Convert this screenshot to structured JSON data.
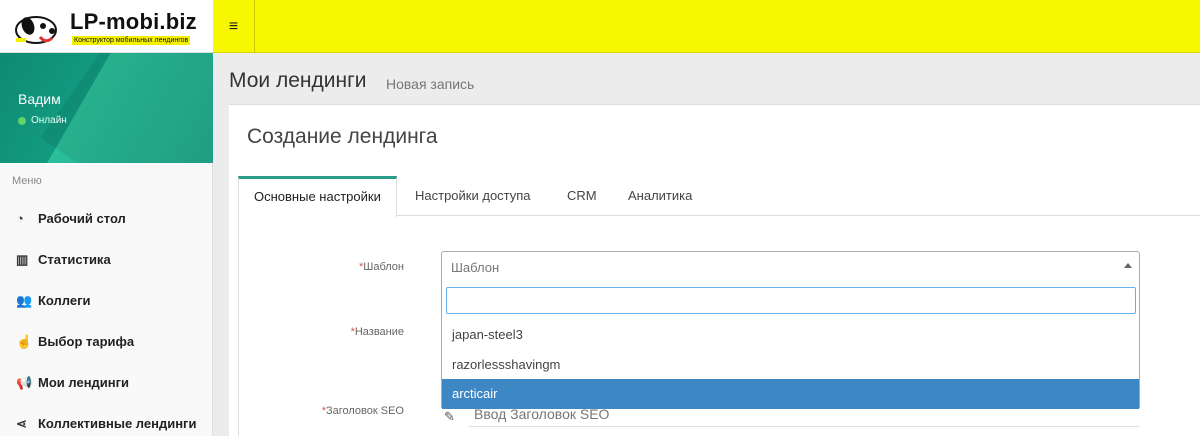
{
  "brand": {
    "title": "LP-mobi.biz",
    "subtitle": "Конструктор мобильных лендингов"
  },
  "topbar": {
    "menu_toggle_icon": "hamburger-icon",
    "menu_toggle_glyph": "≡"
  },
  "user": {
    "name": "Вадим",
    "status": "Онлайн",
    "status_color": "#5fd36a"
  },
  "sidebar": {
    "header": "Меню",
    "items": [
      {
        "label": "Рабочий стол",
        "icon": "dashboard-icon",
        "glyph": "◔"
      },
      {
        "label": "Статистика",
        "icon": "bar-chart-icon",
        "glyph": "▥"
      },
      {
        "label": "Коллеги",
        "icon": "users-icon",
        "glyph": "👥"
      },
      {
        "label": "Выбор тарифа",
        "icon": "hand-pointer-icon",
        "glyph": "☝"
      },
      {
        "label": "Мои лендинги",
        "icon": "bullhorn-icon",
        "glyph": "📢"
      },
      {
        "label": "Коллективные лендинги",
        "icon": "share-icon",
        "glyph": "⋖"
      }
    ]
  },
  "page": {
    "title": "Мои лендинги",
    "subtitle": "Новая запись"
  },
  "box": {
    "title": "Создание лендинга"
  },
  "tabs": [
    {
      "label": "Основные настройки",
      "active": true
    },
    {
      "label": "Настройки доступа",
      "active": false
    },
    {
      "label": "CRM",
      "active": false
    },
    {
      "label": "Аналитика",
      "active": false
    }
  ],
  "form": {
    "required_mark": "*",
    "template_label": "Шаблон",
    "template_placeholder": "Шаблон",
    "name_label": "Название",
    "seo_label": "Заголовок SEO",
    "seo_placeholder": "Ввод Заголовок SEO",
    "dropdown": {
      "search_value": "",
      "options": [
        "japan-steel3",
        "razorlessshavingm",
        "arcticair"
      ],
      "highlighted": "arcticair"
    }
  },
  "colors": {
    "topbar": "#f7f700",
    "accent": "#2a9c8a",
    "highlight": "#3d87c4",
    "sidebar_panel": "#23ac8e"
  }
}
